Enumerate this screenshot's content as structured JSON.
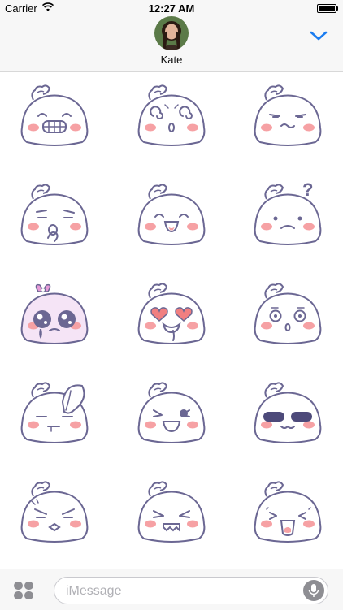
{
  "status_bar": {
    "carrier": "Carrier",
    "time": "12:27 AM"
  },
  "header": {
    "contact_name": "Kate"
  },
  "compose": {
    "placeholder": "iMessage"
  },
  "colors": {
    "accent": "#1a7cf0",
    "outline": "#6b6793",
    "blush": "#f6a1a4",
    "sticker_tint": "#f5e4f6"
  },
  "stickers": [
    {
      "id": "grin",
      "face": "grin"
    },
    {
      "id": "dizzy",
      "face": "dizzy"
    },
    {
      "id": "smug",
      "face": "smug"
    },
    {
      "id": "thinking",
      "face": "thinking"
    },
    {
      "id": "happy",
      "face": "happy"
    },
    {
      "id": "confused",
      "face": "confused"
    },
    {
      "id": "crying-bow",
      "face": "crying"
    },
    {
      "id": "heart-eyes",
      "face": "hearteyes"
    },
    {
      "id": "surprised",
      "face": "surprised"
    },
    {
      "id": "leaf-hat",
      "face": "leaf"
    },
    {
      "id": "excited",
      "face": "excited"
    },
    {
      "id": "cool",
      "face": "cool"
    },
    {
      "id": "angry",
      "face": "angry"
    },
    {
      "id": "furious",
      "face": "furious"
    },
    {
      "id": "crying-out",
      "face": "cryout"
    }
  ]
}
